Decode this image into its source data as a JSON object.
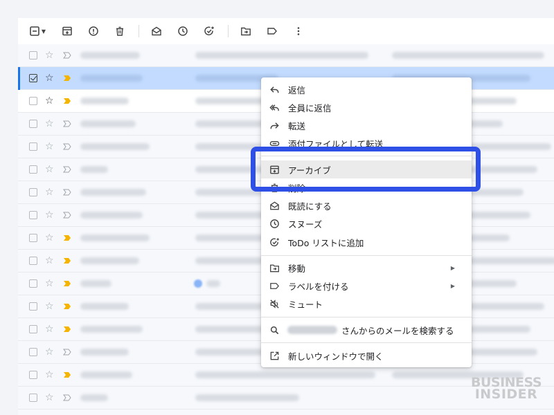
{
  "toolbar": {
    "buttons": [
      "select-checkbox",
      "archive",
      "report-spam",
      "delete",
      "mark-as-read",
      "snooze",
      "add-to-tasks",
      "move-to",
      "labels",
      "more"
    ]
  },
  "mail_rows": [
    {
      "state": "read",
      "checked": false,
      "important": false
    },
    {
      "state": "selected",
      "checked": true,
      "important": true
    },
    {
      "state": "unread",
      "checked": false,
      "important": true
    },
    {
      "state": "read",
      "checked": false,
      "important": false
    },
    {
      "state": "read",
      "checked": false,
      "important": false
    },
    {
      "state": "read",
      "checked": false,
      "important": false
    },
    {
      "state": "read",
      "checked": false,
      "important": false
    },
    {
      "state": "read",
      "checked": false,
      "important": false
    },
    {
      "state": "read",
      "checked": false,
      "important": true
    },
    {
      "state": "read",
      "checked": false,
      "important": true
    },
    {
      "state": "read",
      "checked": false,
      "important": true
    },
    {
      "state": "read",
      "checked": false,
      "important": true
    },
    {
      "state": "read",
      "checked": false,
      "important": true
    },
    {
      "state": "read",
      "checked": false,
      "important": false
    },
    {
      "state": "read",
      "checked": false,
      "important": true
    },
    {
      "state": "read",
      "checked": false,
      "important": false
    }
  ],
  "context_menu": {
    "reply": "返信",
    "reply_all": "全員に返信",
    "forward": "転送",
    "forward_as_attachment": "添付ファイルとして転送",
    "archive": "アーカイブ",
    "delete": "削除",
    "mark_as_read": "既読にする",
    "snooze": "スヌーズ",
    "add_to_tasks": "ToDo リストに追加",
    "move_to": "移動",
    "label_as": "ラベルを付ける",
    "mute": "ミュート",
    "search_from": "さんからのメールを検索する",
    "open_new_window": "新しいウィンドウで開く"
  },
  "highlighted_item": "archive",
  "colors": {
    "highlight_border": "#2e50e6",
    "selected_row": "#c2dbff",
    "important_marker": "#f4b400",
    "background": "#f6f8fc"
  },
  "watermark": {
    "line1": "BUSINESS",
    "line2": "INSIDER"
  }
}
